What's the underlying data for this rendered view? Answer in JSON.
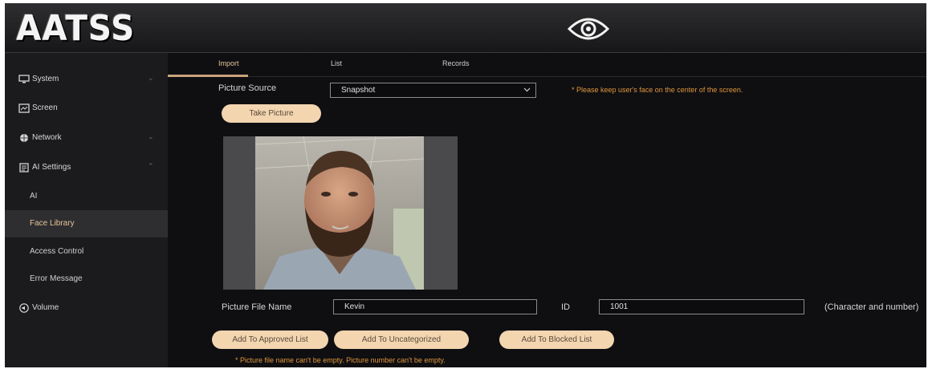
{
  "header": {
    "logo": "AATSS",
    "eye_icon": "eye-icon"
  },
  "sidebar": {
    "items": [
      {
        "label": "System",
        "icon": "monitor-icon",
        "chevron": "⌄"
      },
      {
        "label": "Screen",
        "icon": "screen-icon"
      },
      {
        "label": "Network",
        "icon": "globe-icon",
        "chevron": "⌄"
      },
      {
        "label": "AI Settings",
        "icon": "ai-settings-icon",
        "chevron": "⌃"
      }
    ],
    "sub_items": [
      {
        "label": "AI"
      },
      {
        "label": "Face Library",
        "active": true
      },
      {
        "label": "Access Control"
      },
      {
        "label": "Error Message"
      }
    ],
    "volume": {
      "label": "Volume",
      "icon": "volume-icon"
    }
  },
  "tabs": [
    {
      "label": "Import",
      "active": true
    },
    {
      "label": "List"
    },
    {
      "label": "Records"
    }
  ],
  "picture_source": {
    "label": "Picture Source",
    "value": "Snapshot",
    "hint": "* Please keep user's face on the center of the screen."
  },
  "take_picture_button": "Take Picture",
  "file_name": {
    "label": "Picture File Name",
    "value": "Kevin"
  },
  "id_field": {
    "label": "ID",
    "value": "1001",
    "note": "(Character and number)"
  },
  "actions": {
    "approved": "Add To Approved List",
    "uncategorized": "Add To Uncategorized",
    "blocked": "Add To Blocked List"
  },
  "error_hint": "* Picture file name can't be empty. Picture number can't be empty.",
  "colors": {
    "accent": "#e7c49a",
    "button": "#f3d5b0",
    "warning": "#e0963a",
    "background": "#111114"
  }
}
